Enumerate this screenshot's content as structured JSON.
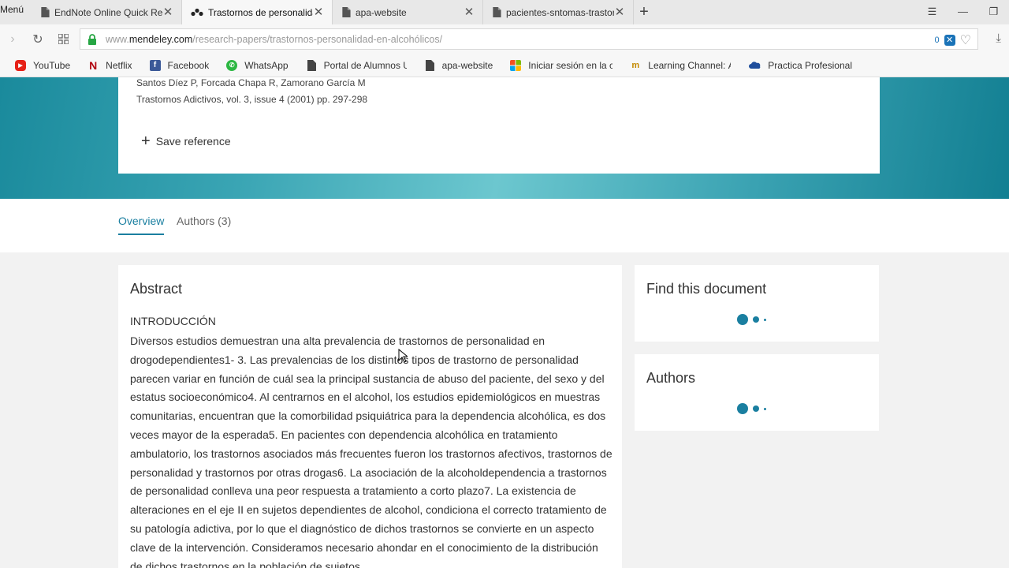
{
  "browser": {
    "menu_label": "Menú",
    "tabs": [
      {
        "title": "EndNote Online Quick Ref",
        "icon": "document-icon",
        "active": false
      },
      {
        "title": "Trastornos de personalidad",
        "icon": "mendeley-icon",
        "active": true
      },
      {
        "title": "apa-website",
        "icon": "document-icon",
        "active": false
      },
      {
        "title": "pacientes-sntomas-trastor",
        "icon": "document-icon",
        "active": false
      }
    ],
    "url": {
      "prefix": "www.",
      "host": "mendeley.com",
      "path": "/research-papers/trastornos-personalidad-en-alcohólicos/"
    },
    "blocker_count": "0",
    "bookmarks": [
      {
        "label": "YouTube",
        "icon": "youtube-icon",
        "color": "#e62117"
      },
      {
        "label": "Netflix",
        "icon": "netflix-icon",
        "color": "#b20710"
      },
      {
        "label": "Facebook",
        "icon": "facebook-icon",
        "color": "#3b5998"
      },
      {
        "label": "WhatsApp",
        "icon": "whatsapp-icon",
        "color": "#2cb742"
      },
      {
        "label": "Portal de Alumnos U",
        "icon": "document-icon",
        "color": "#333333"
      },
      {
        "label": "apa-website",
        "icon": "document-icon",
        "color": "#333333"
      },
      {
        "label": "Iniciar sesión en la c",
        "icon": "microsoft-icon",
        "color": "#f25022"
      },
      {
        "label": "Learning Channel: Á",
        "icon": "learning-channel-icon",
        "color": "#c48a00"
      },
      {
        "label": "Practica Profesional",
        "icon": "onedrive-icon",
        "color": "#1f4e9c"
      }
    ]
  },
  "reference": {
    "authors": "Santos Díez P, Forcada Chapa R, Zamorano García M",
    "journal": "Trastornos Adictivos, vol. 3, issue 4 (2001) pp. 297-298",
    "save_label": "Save reference"
  },
  "page_tabs": [
    {
      "label": "Overview",
      "active": true
    },
    {
      "label": "Authors (3)",
      "active": false
    }
  ],
  "abstract": {
    "title": "Abstract",
    "section": "INTRODUCCIÓN",
    "body": "Diversos estudios demuestran una alta prevalencia de trastornos de personalidad en drogodependientes1- 3. Las prevalencias de los distintos tipos de trastorno de personalidad parecen variar en función de cuál sea la principal sustancia de abuso del paciente, del sexo y del estatus socioeconómico4. Al centrarnos en el alcohol, los estudios epidemiológicos en muestras comunitarias, encuentran que la comorbilidad psiquiátrica para la dependencia alcohólica, es dos veces mayor de la esperada5. En pacientes con dependencia alcohólica en tratamiento ambulatorio, los trastornos asociados más frecuentes fueron los trastornos afectivos, trastornos de personalidad y trastornos por otras drogas6. La asociación de la alcoholdependencia a trastornos de personalidad conlleva una peor respuesta a tratamiento a corto plazo7. La existencia de alteraciones en el eje II en sujetos dependientes de alcohol, condiciona el correcto tratamiento de su patología adictiva, por lo que el diagnóstico de dichos trastornos se convierte en un aspecto clave de la intervención. Consideramos necesario ahondar en el conocimiento de la distribución de dichos trastornos en la población de sujetos"
  },
  "sidebar": {
    "find_title": "Find this document",
    "authors_title": "Authors"
  },
  "colors": {
    "accent": "#1a7fa0",
    "hero_teal": "#3aa5b4"
  }
}
